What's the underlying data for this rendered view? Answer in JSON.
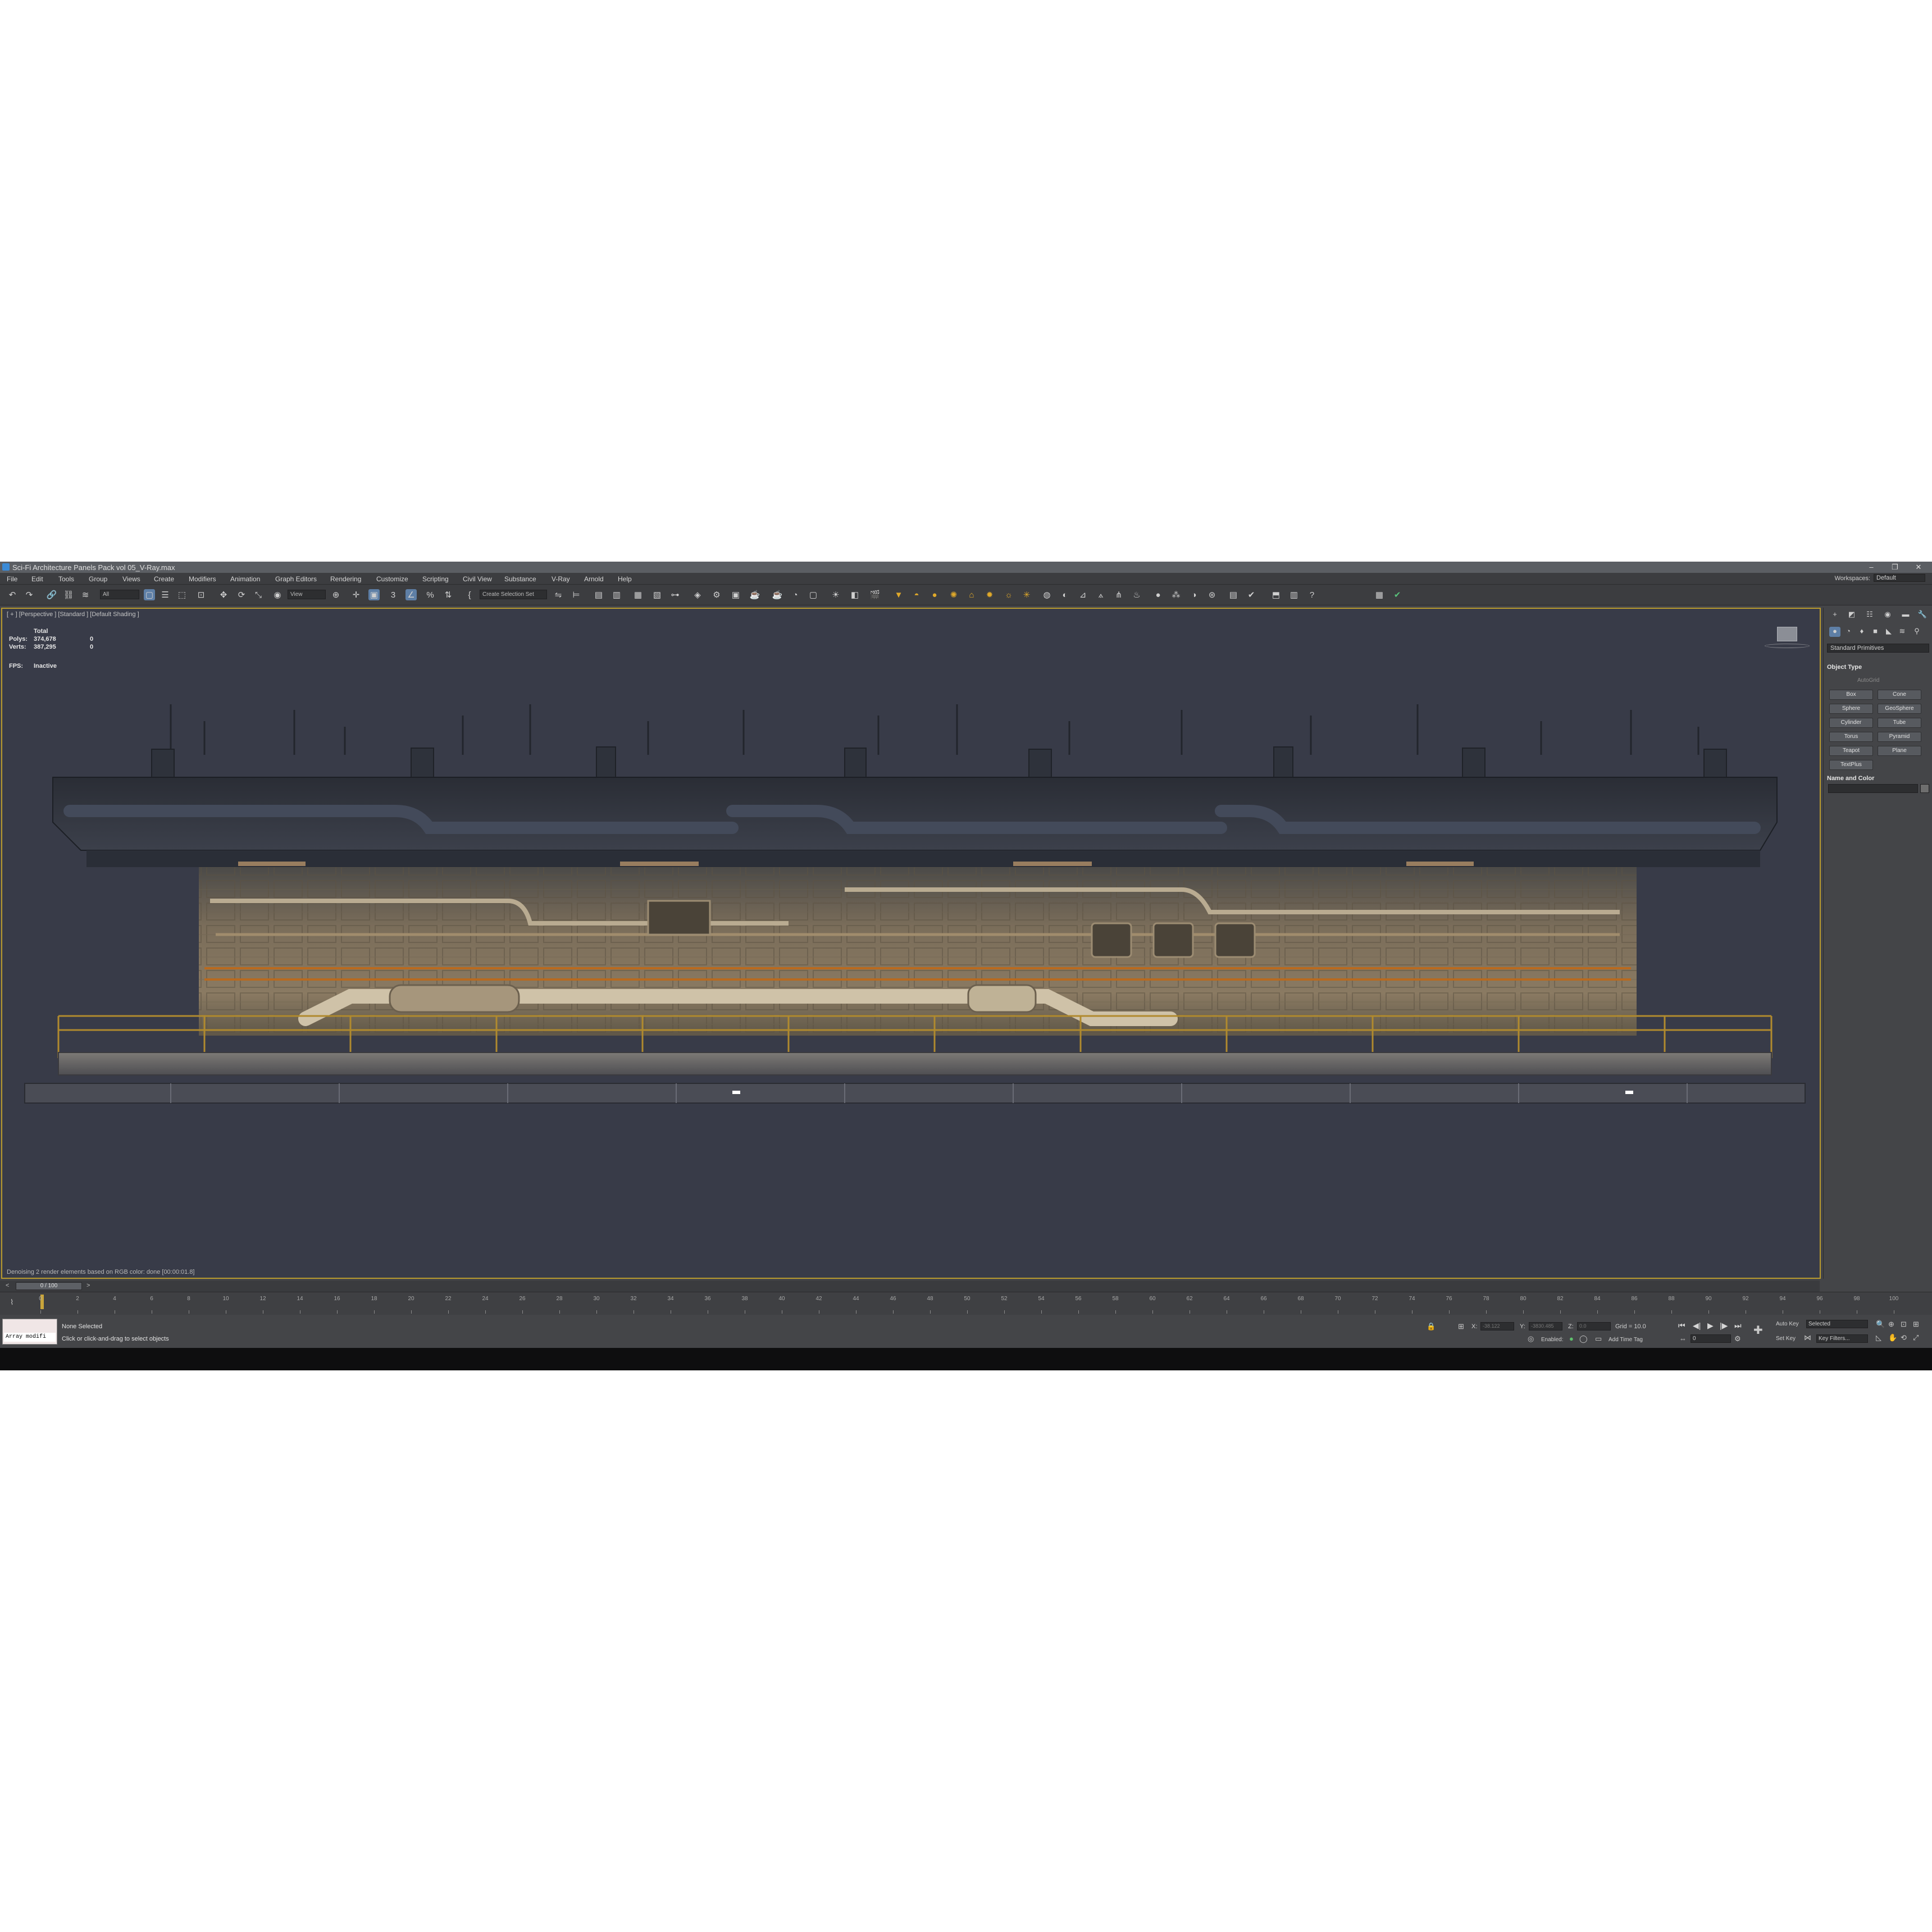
{
  "window": {
    "title": "Sci-Fi Architecture Panels Pack vol 05_V-Ray.max",
    "controls": [
      "–",
      "❐",
      "✕"
    ]
  },
  "menu": {
    "items": [
      "File",
      "Edit",
      "Tools",
      "Group",
      "Views",
      "Create",
      "Modifiers",
      "Animation",
      "Graph Editors",
      "Rendering",
      "Customize",
      "Scripting",
      "Civil View",
      "Substance",
      "V-Ray",
      "Arnold",
      "Help"
    ],
    "workspaces_label": "Workspaces:",
    "workspaces_value": "Default"
  },
  "toolbar": {
    "selection_filter": "All",
    "ref_coord": "View",
    "named_selection": "Create Selection Set"
  },
  "viewport": {
    "label": "[ + ] [Perspective ] [Standard ] [Default Shading ]",
    "stats_header": "Total",
    "polys_label": "Polys:",
    "polys_total": "374,678",
    "polys_selected": "0",
    "verts_label": "Verts:",
    "verts_total": "387,295",
    "verts_selected": "0",
    "fps_label": "FPS:",
    "fps_value": "Inactive",
    "denoise_msg": "Denoising 2 render elements based on RGB color: done [00:00:01.8]"
  },
  "command_panel": {
    "category_dropdown": "Standard Primitives",
    "object_type_title": "Object Type",
    "autogrid_label": "AutoGrid",
    "primitives": [
      "Box",
      "Cone",
      "Sphere",
      "GeoSphere",
      "Cylinder",
      "Tube",
      "Torus",
      "Pyramid",
      "Teapot",
      "Plane",
      "TextPlus"
    ],
    "name_color_title": "Name and Color"
  },
  "timeline": {
    "frame_slider": "0 / 100",
    "ticks": [
      "0",
      "2",
      "4",
      "6",
      "8",
      "10",
      "12",
      "14",
      "16",
      "18",
      "20",
      "22",
      "24",
      "26",
      "28",
      "30",
      "32",
      "34",
      "36",
      "38",
      "40",
      "42",
      "44",
      "46",
      "48",
      "50",
      "52",
      "54",
      "56",
      "58",
      "60",
      "62",
      "64",
      "66",
      "68",
      "70",
      "72",
      "74",
      "76",
      "78",
      "80",
      "82",
      "84",
      "86",
      "88",
      "90",
      "92",
      "94",
      "96",
      "98",
      "100"
    ]
  },
  "status": {
    "maxscript_text": "Array modifi",
    "selection": "None Selected",
    "prompt": "Click or click-and-drag to select objects",
    "x_label": "X:",
    "x_value": "-38.122",
    "y_label": "Y:",
    "y_value": "-3830.485",
    "z_label": "Z:",
    "z_value": "0.0",
    "grid": "Grid = 10.0",
    "enabled_label": "Enabled:",
    "add_time_tag": "Add Time Tag",
    "auto_key": "Auto Key",
    "auto_key_mode": "Selected",
    "set_key": "Set Key",
    "key_filters": "Key Filters...",
    "current_frame": "0"
  },
  "colors": {
    "viewport_bg": "#383b48",
    "active_border": "#b89a2e",
    "ui_bg": "#444548",
    "time_cursor": "#c9a53b"
  }
}
